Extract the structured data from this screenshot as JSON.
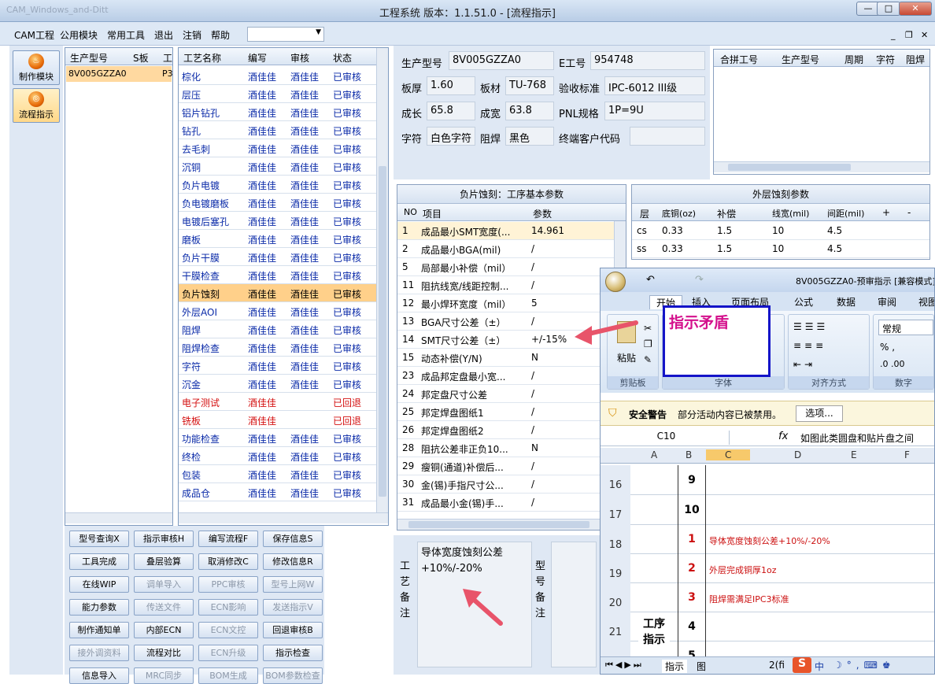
{
  "window": {
    "title": "工程系统   版本：1.1.51.0 - [流程指示]",
    "faded_title": "CAM_Windows_and-Ditt"
  },
  "menu": [
    "CAM工程",
    "公用模块",
    "常用工具",
    "退出",
    "注销",
    "帮助"
  ],
  "left_buttons": [
    {
      "label": "制作模块",
      "icon": "flame-icon"
    },
    {
      "label": "流程指示",
      "icon": "gauge-icon"
    }
  ],
  "model_grid": {
    "headers": [
      "生产型号",
      "S板",
      "工"
    ],
    "rows": [
      {
        "model": "8V005GZZA0",
        "extra": "P3"
      }
    ]
  },
  "process_grid": {
    "headers": [
      "工艺名称",
      "编写",
      "审核",
      "状态"
    ],
    "rows": [
      {
        "name": "棕化",
        "writer": "酒佳佳",
        "checker": "酒佳佳",
        "status": "已审核"
      },
      {
        "name": "层压",
        "writer": "酒佳佳",
        "checker": "酒佳佳",
        "status": "已审核"
      },
      {
        "name": "铝片钻孔",
        "writer": "酒佳佳",
        "checker": "酒佳佳",
        "status": "已审核"
      },
      {
        "name": "钻孔",
        "writer": "酒佳佳",
        "checker": "酒佳佳",
        "status": "已审核"
      },
      {
        "name": "去毛刺",
        "writer": "酒佳佳",
        "checker": "酒佳佳",
        "status": "已审核"
      },
      {
        "name": "沉铜",
        "writer": "酒佳佳",
        "checker": "酒佳佳",
        "status": "已审核"
      },
      {
        "name": "负片电镀",
        "writer": "酒佳佳",
        "checker": "酒佳佳",
        "status": "已审核"
      },
      {
        "name": "负电镀磨板",
        "writer": "酒佳佳",
        "checker": "酒佳佳",
        "status": "已审核"
      },
      {
        "name": "电镀后塞孔",
        "writer": "酒佳佳",
        "checker": "酒佳佳",
        "status": "已审核"
      },
      {
        "name": "磨板",
        "writer": "酒佳佳",
        "checker": "酒佳佳",
        "status": "已审核"
      },
      {
        "name": "负片干膜",
        "writer": "酒佳佳",
        "checker": "酒佳佳",
        "status": "已审核"
      },
      {
        "name": "干膜检查",
        "writer": "酒佳佳",
        "checker": "酒佳佳",
        "status": "已审核"
      },
      {
        "name": "负片蚀刻",
        "writer": "酒佳佳",
        "checker": "酒佳佳",
        "status": "已审核"
      },
      {
        "name": "外层AOI",
        "writer": "酒佳佳",
        "checker": "酒佳佳",
        "status": "已审核"
      },
      {
        "name": "阻焊",
        "writer": "酒佳佳",
        "checker": "酒佳佳",
        "status": "已审核"
      },
      {
        "name": "阻焊检查",
        "writer": "酒佳佳",
        "checker": "酒佳佳",
        "status": "已审核"
      },
      {
        "name": "字符",
        "writer": "酒佳佳",
        "checker": "酒佳佳",
        "status": "已审核"
      },
      {
        "name": "沉金",
        "writer": "酒佳佳",
        "checker": "酒佳佳",
        "status": "已审核"
      },
      {
        "name": "电子测试",
        "writer": "酒佳佳",
        "checker": "",
        "status": "已回退"
      },
      {
        "name": "铣板",
        "writer": "酒佳佳",
        "checker": "",
        "status": "已回退"
      },
      {
        "name": "功能检查",
        "writer": "酒佳佳",
        "checker": "酒佳佳",
        "status": "已审核"
      },
      {
        "name": "终检",
        "writer": "酒佳佳",
        "checker": "酒佳佳",
        "status": "已审核"
      },
      {
        "name": "包装",
        "writer": "酒佳佳",
        "checker": "酒佳佳",
        "status": "已审核"
      },
      {
        "name": "成品仓",
        "writer": "酒佳佳",
        "checker": "酒佳佳",
        "status": "已审核"
      }
    ],
    "selected_index": 12,
    "colors": {
      "normal": "#0a2aa8",
      "returned": "#d41010",
      "selected_bg": "#ffd08a"
    }
  },
  "buttons": [
    [
      "型号查询X",
      "指示审核H",
      "编写流程F",
      "保存信息S"
    ],
    [
      "工具完成",
      "叠层验算",
      "取消修改C",
      "修改信息R"
    ],
    [
      "在线WIP",
      "调单导入",
      "PPC审核",
      "型号上网W"
    ],
    [
      "能力参数",
      "传送文件",
      "ECN影响",
      "发送指示V"
    ],
    [
      "制作通知单",
      "内部ECN",
      "ECN文控",
      "回退审核B"
    ],
    [
      "接外调资料",
      "流程对比",
      "ECN升级",
      "指示检查"
    ],
    [
      "信息导入",
      "MRC同步",
      "BOM生成",
      "BOM参数检查"
    ]
  ],
  "disabled_buttons": [
    "调单导入",
    "PPC审核",
    "型号上网W",
    "传送文件",
    "ECN影响",
    "发送指示V",
    "ECN文控",
    "接外调资料",
    "ECN升级",
    "MRC同步",
    "BOM生成",
    "BOM参数检查"
  ],
  "info": {
    "model_label": "生产型号",
    "model": "8V005GZZA0",
    "eno_label": "E工号",
    "eno": "954748",
    "thick_label": "板厚",
    "thick": "1.60",
    "mat_label": "板材",
    "mat": "TU-768",
    "std_label": "验收标准",
    "std": "IPC-6012 III级",
    "len_label": "成长",
    "len": "65.8",
    "wid_label": "成宽",
    "wid": "63.8",
    "pnl_label": "PNL规格",
    "pnl": "1P=9U",
    "char_label": "字符",
    "char": "白色字符",
    "mask_label": "阻焊",
    "mask": "黑色",
    "cust_label": "终端客户代码",
    "cust": ""
  },
  "combine_panel": {
    "headers": [
      "合拼工号",
      "生产型号",
      "周期",
      "字符",
      "阻焊"
    ]
  },
  "neg_etch": {
    "title": "负片蚀刻：工序基本参数",
    "headers": [
      "NO",
      "项目",
      "参数"
    ],
    "rows": [
      {
        "no": "1",
        "item": "成品最小SMT宽度(...",
        "val": "14.961"
      },
      {
        "no": "2",
        "item": "成品最小BGA(mil)",
        "val": "/"
      },
      {
        "no": "5",
        "item": "局部最小补偿（mil）",
        "val": "/"
      },
      {
        "no": "11",
        "item": "阻抗线宽/线距控制...",
        "val": "/"
      },
      {
        "no": "12",
        "item": "最小焊环宽度（mil）",
        "val": "5"
      },
      {
        "no": "13",
        "item": "BGA尺寸公差（±）",
        "val": "/"
      },
      {
        "no": "14",
        "item": "SMT尺寸公差（±）",
        "val": "+/-15%"
      },
      {
        "no": "15",
        "item": "动态补偿(Y/N)",
        "val": "N"
      },
      {
        "no": "23",
        "item": "成品邦定盘最小宽...",
        "val": "/"
      },
      {
        "no": "24",
        "item": "邦定盘尺寸公差",
        "val": "/"
      },
      {
        "no": "25",
        "item": "邦定焊盘图纸1",
        "val": "/"
      },
      {
        "no": "26",
        "item": "邦定焊盘图纸2",
        "val": "/"
      },
      {
        "no": "28",
        "item": "阻抗公差非正负10...",
        "val": "N"
      },
      {
        "no": "29",
        "item": "瘦铜(通道)补偿后...",
        "val": "/"
      },
      {
        "no": "30",
        "item": "金(锡)手指尺寸公...",
        "val": "/"
      },
      {
        "no": "31",
        "item": "成品最小金(锡)手...",
        "val": "/"
      }
    ]
  },
  "outer_etch": {
    "title": "外层蚀刻参数",
    "headers": [
      "层",
      "底铜(oz)",
      "补偿",
      "线宽(mil)",
      "间距(mil)",
      "+",
      "-"
    ],
    "rows": [
      {
        "layer": "cs",
        "oz": "0.33",
        "comp": "1.5",
        "line": "10",
        "space": "4.5"
      },
      {
        "layer": "ss",
        "oz": "0.33",
        "comp": "1.5",
        "line": "10",
        "space": "4.5"
      }
    ]
  },
  "remarks": {
    "craft_label": "工艺备注",
    "craft_text": "导体宽度蚀刻公差\n+10%/-20%",
    "model_label": "型号备注"
  },
  "excel": {
    "title": "8V005GZZA0-预审指示  [兼容模式]",
    "tabs": [
      "开始",
      "插入",
      "页面布局",
      "公式",
      "数据",
      "审阅",
      "视图"
    ],
    "clipboard_group": "剪贴板",
    "paste": "粘贴",
    "font_group": "字体",
    "align_group": "对齐方式",
    "number_group": "数字",
    "number_format": "常规",
    "warning_label": "安全警告",
    "warning_text": "部分活动内容已被禁用。",
    "options_button": "选项...",
    "cell_ref": "C10",
    "formula": "如图此类圆盘和贴片盘之间",
    "columns": [
      "A",
      "B",
      "C",
      "D",
      "E",
      "F"
    ],
    "rows": [
      {
        "num": "16",
        "b": "9",
        "text": ""
      },
      {
        "num": "17",
        "b": "10",
        "text": ""
      },
      {
        "num": "18",
        "b": "1",
        "text": "导体宽度蚀刻公差+10%/-20%"
      },
      {
        "num": "19",
        "b": "2",
        "text": "外层完成铜厚1oz"
      },
      {
        "num": "20",
        "b": "3",
        "text": "阻焊需满足IPC3标准"
      },
      {
        "num": "21",
        "b": "4",
        "text": ""
      },
      {
        "num": "",
        "b": "5",
        "text": ""
      }
    ],
    "section_label": "工序\n指示",
    "sheet_tabs": [
      "指示",
      "图",
      "2(fi"
    ]
  },
  "annotation": {
    "callout": "指示矛盾",
    "arrow_color": "#e8546a"
  }
}
